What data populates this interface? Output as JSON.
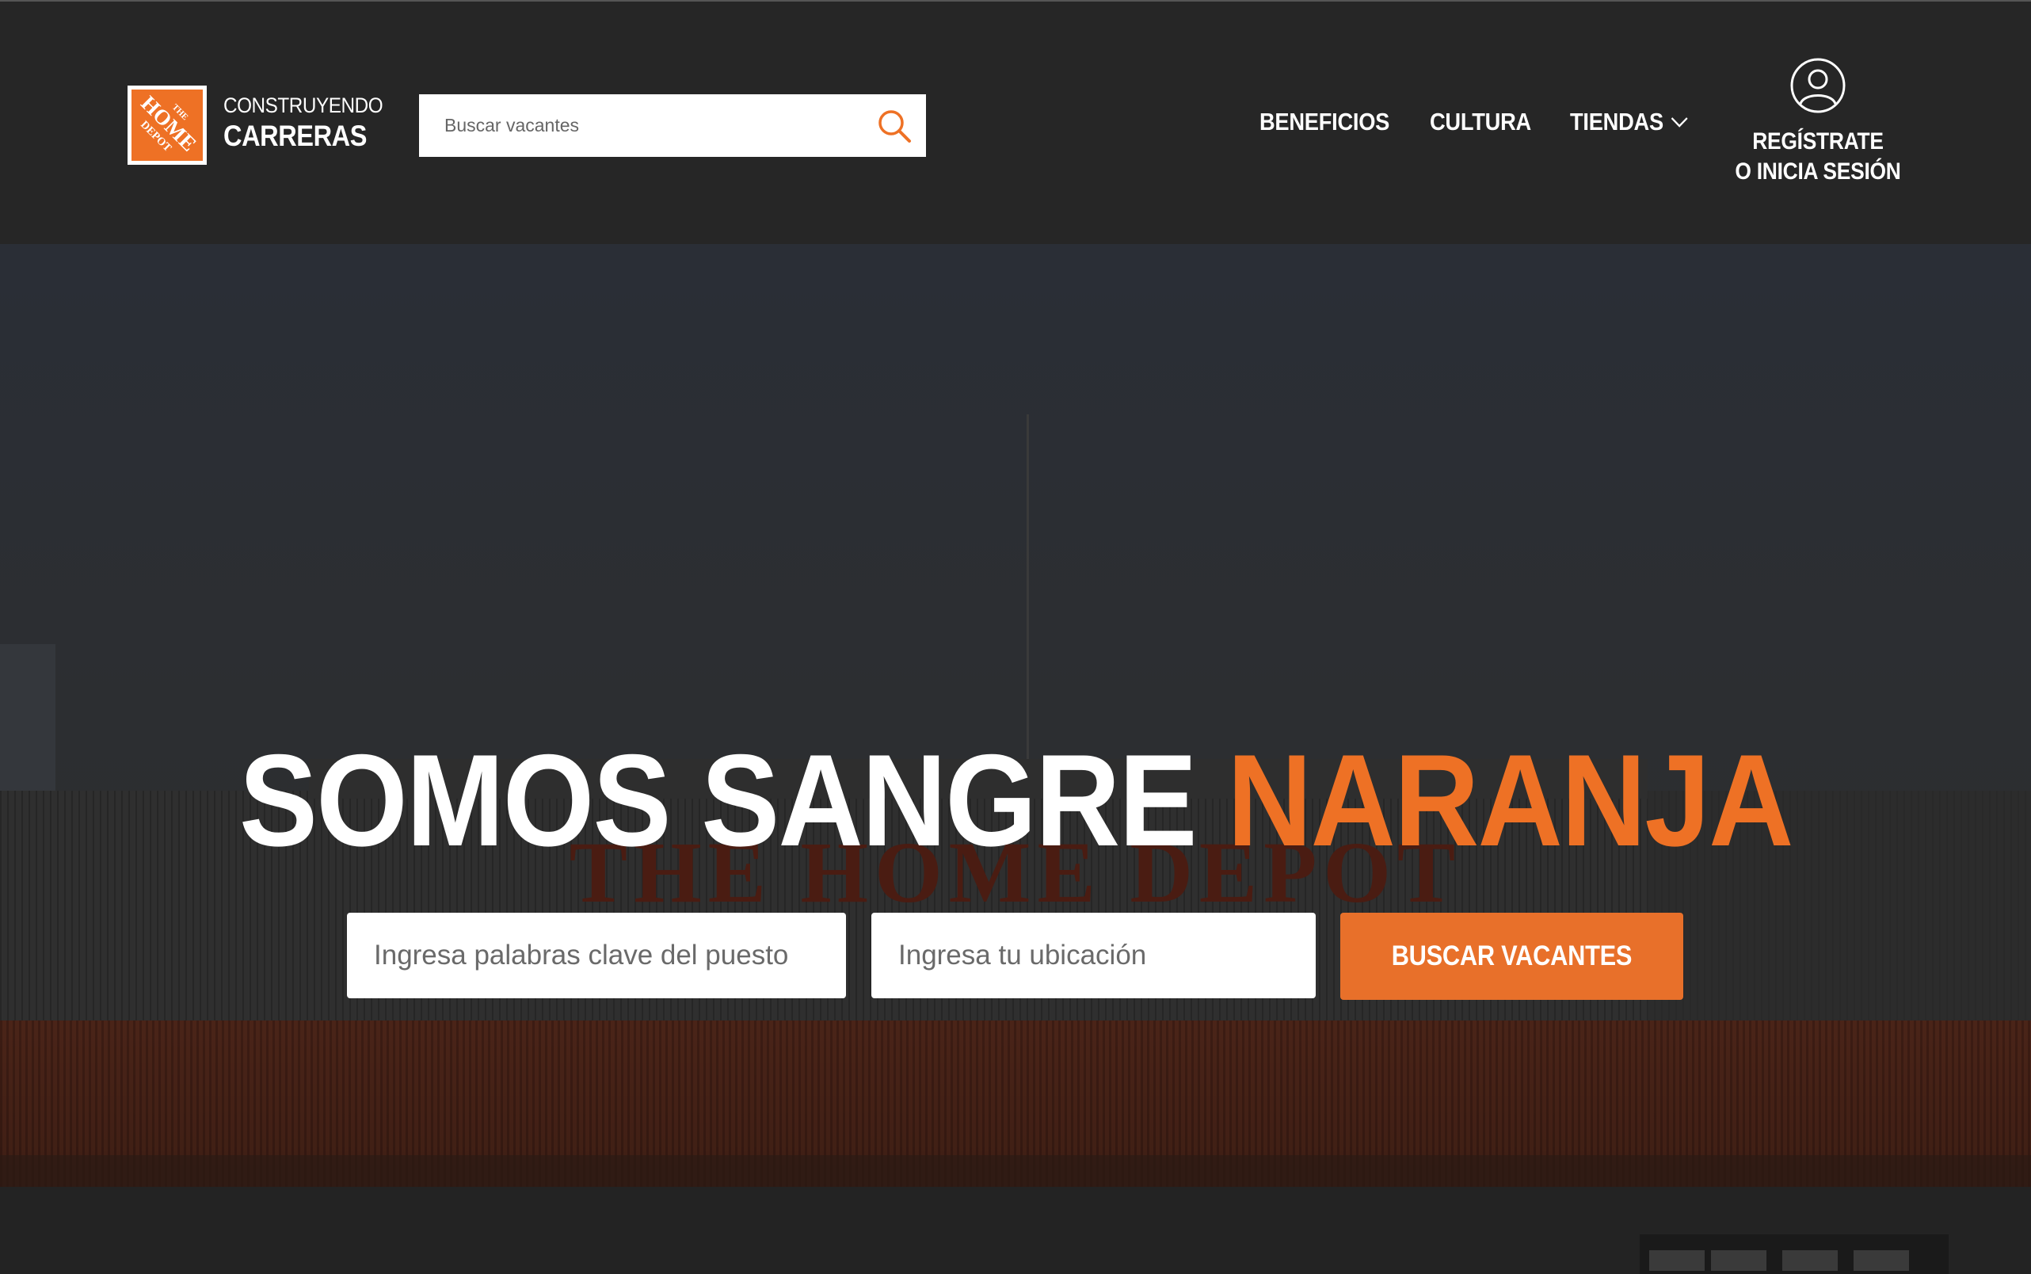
{
  "brand": {
    "logo_name": "The Home Depot",
    "logo_lines": [
      "THE",
      "HOME",
      "DEPOT"
    ],
    "tagline_top": "CONSTRUYENDO",
    "tagline_bottom": "CARRERAS",
    "orange": "#ee7125"
  },
  "header": {
    "search_placeholder": "Buscar vacantes",
    "search_icon": "search-icon"
  },
  "nav": {
    "items": [
      {
        "label": "BENEFICIOS"
      },
      {
        "label": "CULTURA"
      },
      {
        "label": "TIENDAS",
        "icon": "chevron-down-icon"
      }
    ]
  },
  "account": {
    "icon": "user-icon",
    "line1": "REGÍSTRATE",
    "line2": "O INICIA SESIÓN"
  },
  "hero": {
    "title_white": "SOMOS SANGRE",
    "title_orange": "NARANJA",
    "keywords_placeholder": "Ingresa palabras clave del puesto",
    "location_placeholder": "Ingresa tu ubicación",
    "button_label": "BUSCAR VACANTES",
    "button_color": "#e8702a"
  }
}
